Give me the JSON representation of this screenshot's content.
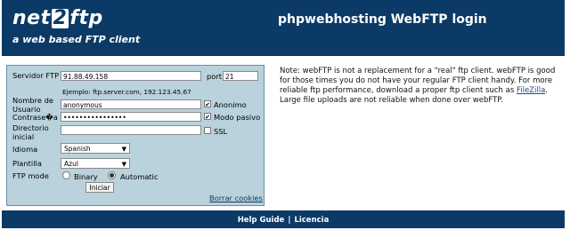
{
  "header": {
    "logo_brand_prefix": "net",
    "logo_brand_num": "2",
    "logo_brand_suffix": "ftp",
    "logo_tagline": "a web based FTP client",
    "title": "phpwebhosting WebFTP login"
  },
  "form": {
    "server_label": "Servidor FTP",
    "server_value": "91.88.49.158",
    "port_label": "port",
    "port_value": "21",
    "example_hint": "Ejemplo: ftp.server.com, 192.123.45.67",
    "username_label": "Nombre de Usuario",
    "username_value": "anonymous",
    "anonymous_label": "Anonimo",
    "anonymous_checked": "✔",
    "password_label": "Contrase�a",
    "password_value": "••••••••••••••••",
    "passive_label": "Modo pasivo",
    "passive_checked": "✔",
    "dir_label": "Directorio inicial",
    "dir_value": "",
    "ssl_label": "SSL",
    "language_label": "Idioma",
    "language_value": "Spanish",
    "skin_label": "Plantilla",
    "skin_value": "Azul",
    "ftpmode_label": "FTP mode",
    "binary_label": "Binary",
    "automatic_label": "Automatic",
    "submit_label": "Iniciar",
    "clear_cookies_label": "Borrar cookies"
  },
  "note": {
    "text_before": "Note: webFTP is not a replacement for a \"real\" ftp client. webFTP is good for those times you do not have your regular FTP client handy. For more reliable ftp performance, download a proper ftp client such as ",
    "link_label": "FileZilla",
    "text_after": ". Large file uploads are not reliable when done over webFTP."
  },
  "footer": {
    "help_label": "Help Guide",
    "separator": "|",
    "license_label": "Licencia"
  }
}
